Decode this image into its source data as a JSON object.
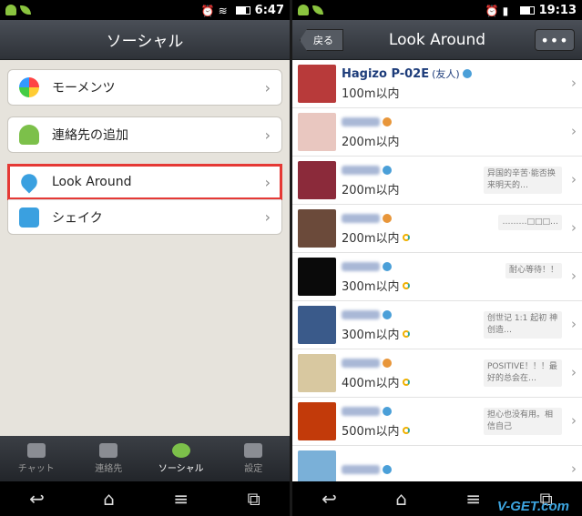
{
  "left": {
    "status_time": "6:47",
    "title": "ソーシャル",
    "menu": [
      {
        "label": "モーメンツ"
      },
      {
        "label": "連絡先の追加"
      },
      {
        "label": "Look Around"
      },
      {
        "label": "シェイク"
      }
    ],
    "tabs": [
      {
        "label": "チャット"
      },
      {
        "label": "連絡先"
      },
      {
        "label": "ソーシャル"
      },
      {
        "label": "設定"
      }
    ]
  },
  "right": {
    "status_time": "19:13",
    "title": "Look Around",
    "back_label": "戻る",
    "more_label": "•••",
    "people": [
      {
        "name": "Hagizo P-02E",
        "tag": "(友人)",
        "distance": "100m以内",
        "signature": ""
      },
      {
        "name": "",
        "tag": "",
        "distance": "200m以内",
        "signature": ""
      },
      {
        "name": "",
        "tag": "",
        "distance": "200m以内",
        "signature": "异国的辛苦·能否换来明天的…"
      },
      {
        "name": "",
        "tag": "",
        "distance": "200m以内",
        "signature": "………□□□…"
      },
      {
        "name": "",
        "tag": "",
        "distance": "300m以内",
        "signature": "耐心等待！！"
      },
      {
        "name": "",
        "tag": "",
        "distance": "300m以内",
        "signature": "创世记 1:1 起初 神创造…"
      },
      {
        "name": "",
        "tag": "",
        "distance": "400m以内",
        "signature": "POSITIVE！！！最好的总会在…"
      },
      {
        "name": "",
        "tag": "",
        "distance": "500m以内",
        "signature": "担心也没有用。相信自己"
      },
      {
        "name": "",
        "tag": "",
        "distance": "",
        "signature": ""
      }
    ]
  },
  "watermark": "V-GET.com"
}
